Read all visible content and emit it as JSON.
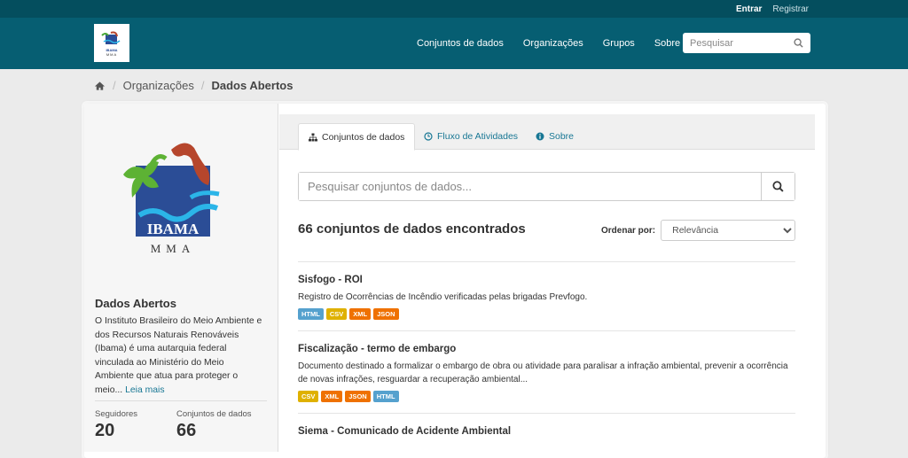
{
  "topbar": {
    "login": "Entrar",
    "register": "Registrar"
  },
  "header": {
    "logo_text": "IBAMA",
    "logo_sub": "MMA",
    "nav": [
      "Conjuntos de dados",
      "Organizações",
      "Grupos",
      "Sobre"
    ],
    "search_placeholder": "Pesquisar"
  },
  "breadcrumb": {
    "home_icon": "home-icon",
    "items": [
      "Organizações",
      "Dados Abertos"
    ]
  },
  "sidebar": {
    "logo_text": "IBAMA",
    "logo_sub": "MMA",
    "title": "Dados Abertos",
    "description": "O Instituto Brasileiro do Meio Ambiente e dos Recursos Naturais Renováveis (Ibama) é uma autarquia federal vinculada ao Ministério do Meio Ambiente que atua para proteger o meio...",
    "read_more": "Leia mais",
    "followers_label": "Seguidores",
    "followers": "20",
    "datasets_label": "Conjuntos de dados",
    "datasets": "66"
  },
  "tabs": [
    {
      "label": "Conjuntos de dados",
      "icon": "sitemap-icon"
    },
    {
      "label": "Fluxo de Atividades",
      "icon": "clock-icon"
    },
    {
      "label": "Sobre",
      "icon": "info-icon"
    }
  ],
  "dataset_search": {
    "placeholder": "Pesquisar conjuntos de dados..."
  },
  "results": {
    "count_text": "66 conjuntos de dados encontrados",
    "order_label": "Ordenar por:",
    "order_value": "Relevância"
  },
  "datasets": [
    {
      "title": "Sisfogo - ROI",
      "notes": "Registro de Ocorrências de Incêndio verificadas pelas brigadas Prevfogo.",
      "formats": [
        {
          "label": "HTML",
          "color": "#55a1ce"
        },
        {
          "label": "CSV",
          "color": "#dfb100"
        },
        {
          "label": "XML",
          "color": "#ef7100"
        },
        {
          "label": "JSON",
          "color": "#ef7100"
        }
      ]
    },
    {
      "title": "Fiscalização - termo de embargo",
      "notes": "Documento destinado a formalizar o embargo de obra ou atividade para paralisar a infração ambiental, prevenir a ocorrência de novas infrações, resguardar a recuperação ambiental...",
      "formats": [
        {
          "label": "CSV",
          "color": "#dfb100"
        },
        {
          "label": "XML",
          "color": "#ef7100"
        },
        {
          "label": "JSON",
          "color": "#ef7100"
        },
        {
          "label": "HTML",
          "color": "#55a1ce"
        }
      ]
    },
    {
      "title": "Siema - Comunicado de Acidente Ambiental",
      "notes": "",
      "formats": []
    }
  ],
  "colors": {
    "topbar": "#044e5e",
    "masthead": "#065e72",
    "link": "#187794"
  }
}
